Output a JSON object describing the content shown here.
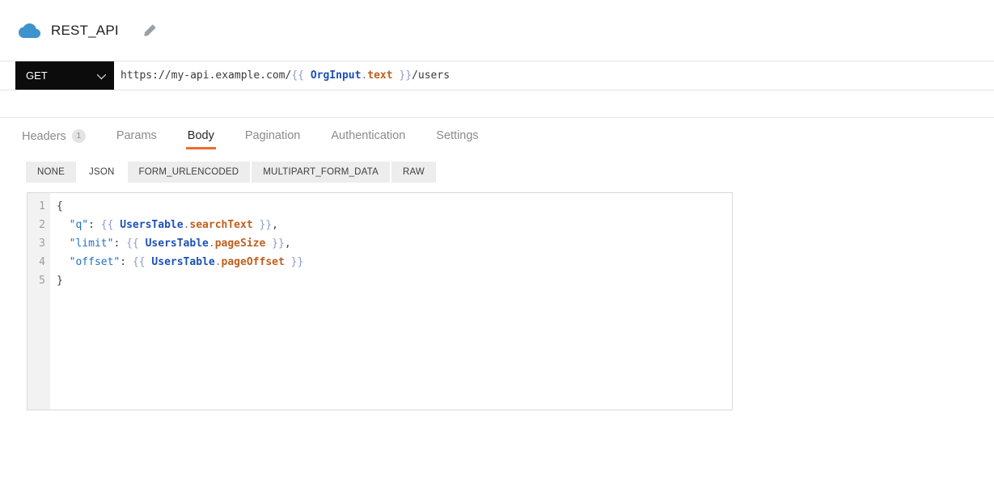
{
  "header": {
    "title": "REST_API",
    "icon": "cloud-icon",
    "edit_icon": "pencil-icon"
  },
  "request_bar": {
    "method": "GET",
    "url_tokens": [
      {
        "t": "plain",
        "v": "https://my-api.example.com/"
      },
      {
        "t": "brace",
        "v": "{{ "
      },
      {
        "t": "entity",
        "v": "OrgInput"
      },
      {
        "t": "dot",
        "v": "."
      },
      {
        "t": "prop",
        "v": "text"
      },
      {
        "t": "brace",
        "v": " }}"
      },
      {
        "t": "plain",
        "v": "/users"
      }
    ]
  },
  "tabs": [
    {
      "label": "Headers",
      "badge": "1",
      "active": false
    },
    {
      "label": "Params",
      "active": false
    },
    {
      "label": "Body",
      "active": true
    },
    {
      "label": "Pagination",
      "active": false
    },
    {
      "label": "Authentication",
      "active": false
    },
    {
      "label": "Settings",
      "active": false
    }
  ],
  "body_type_tabs": [
    {
      "label": "NONE",
      "active": false
    },
    {
      "label": "JSON",
      "active": true
    },
    {
      "label": "FORM_URLENCODED",
      "active": false
    },
    {
      "label": "MULTIPART_FORM_DATA",
      "active": false
    },
    {
      "label": "RAW",
      "active": false
    }
  ],
  "editor": {
    "lines": [
      {
        "num": "1",
        "tokens": [
          {
            "t": "punc",
            "v": "{"
          }
        ]
      },
      {
        "num": "2",
        "tokens": [
          {
            "t": "punc",
            "v": "  "
          },
          {
            "t": "key",
            "v": "\"q\""
          },
          {
            "t": "punc",
            "v": ": "
          },
          {
            "t": "brace",
            "v": "{{ "
          },
          {
            "t": "entity",
            "v": "UsersTable"
          },
          {
            "t": "dot",
            "v": "."
          },
          {
            "t": "prop",
            "v": "searchText"
          },
          {
            "t": "brace",
            "v": " }}"
          },
          {
            "t": "punc",
            "v": ","
          }
        ]
      },
      {
        "num": "3",
        "tokens": [
          {
            "t": "punc",
            "v": "  "
          },
          {
            "t": "key",
            "v": "\"limit\""
          },
          {
            "t": "punc",
            "v": ": "
          },
          {
            "t": "brace",
            "v": "{{ "
          },
          {
            "t": "entity",
            "v": "UsersTable"
          },
          {
            "t": "dot",
            "v": "."
          },
          {
            "t": "prop",
            "v": "pageSize"
          },
          {
            "t": "brace",
            "v": " }}"
          },
          {
            "t": "punc",
            "v": ","
          }
        ]
      },
      {
        "num": "4",
        "tokens": [
          {
            "t": "punc",
            "v": "  "
          },
          {
            "t": "key",
            "v": "\"offset\""
          },
          {
            "t": "punc",
            "v": ": "
          },
          {
            "t": "brace",
            "v": "{{ "
          },
          {
            "t": "entity",
            "v": "UsersTable"
          },
          {
            "t": "dot",
            "v": "."
          },
          {
            "t": "prop",
            "v": "pageOffset"
          },
          {
            "t": "brace",
            "v": " }}"
          }
        ]
      },
      {
        "num": "5",
        "tokens": [
          {
            "t": "punc",
            "v": "}"
          }
        ]
      }
    ]
  },
  "colors": {
    "accent_orange": "#EE6B2F",
    "method_bg": "#0C0C0C",
    "cloud_blue": "#3E93CC",
    "binding_brace": "#8D9DC6",
    "entity_blue": "#1D50B8",
    "property_orange": "#C05F1F",
    "json_key_blue": "#2272C3",
    "divider": "#E5E5E5"
  }
}
